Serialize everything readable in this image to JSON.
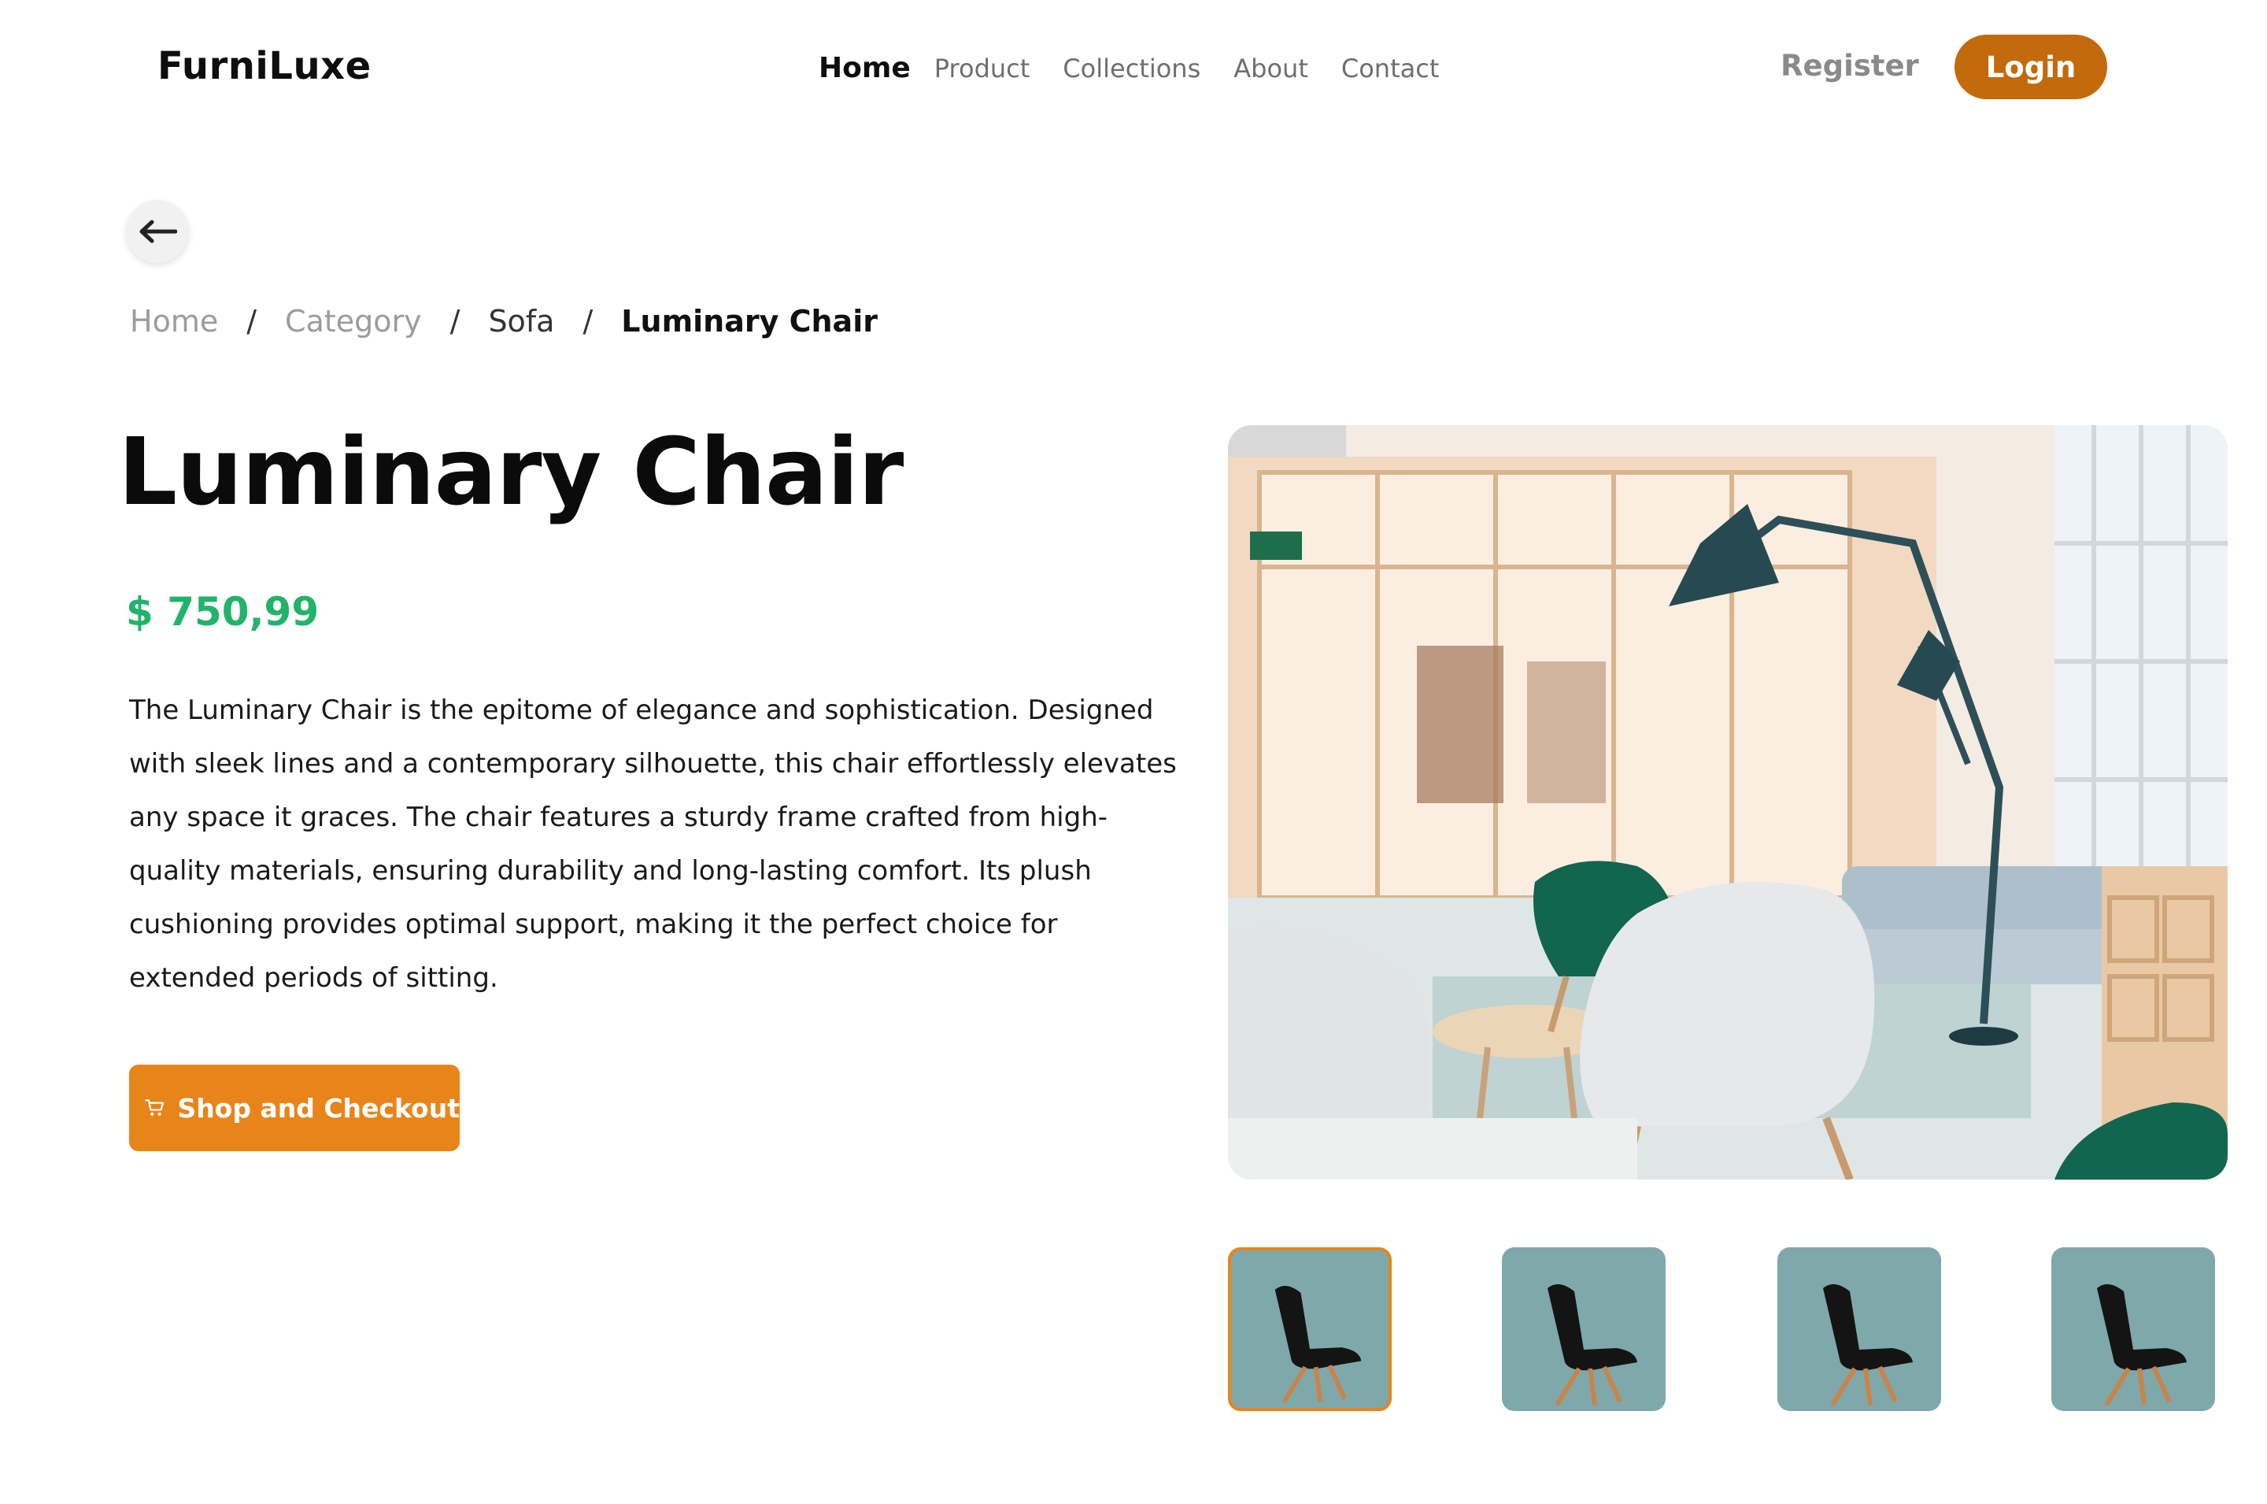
{
  "brand": {
    "name": "FurniLuxe"
  },
  "nav": {
    "items": [
      "Home",
      "Product",
      "Collections",
      "About",
      "Contact"
    ],
    "active": "Home"
  },
  "auth": {
    "register_label": "Register",
    "login_label": "Login"
  },
  "breadcrumb": {
    "home": "Home",
    "category": "Category",
    "sub": "Sofa",
    "current": "Luminary Chair",
    "separator": "/"
  },
  "product": {
    "title": "Luminary Chair",
    "price": "$ 750,99",
    "description_lines": [
      "The Luminary Chair is the epitome of elegance and sophistication. Designed",
      "with sleek lines and a contemporary silhouette, this chair effortlessly elevates",
      "any space it graces. The chair features a sturdy frame crafted from high-",
      "quality materials, ensuring durability and long-lasting comfort. Its plush",
      "cushioning provides optimal support, making it the perfect choice for",
      "extended periods of sitting."
    ],
    "cta_label": "Shop and Checkout",
    "thumbnail_count": 4,
    "active_thumbnail": 1
  },
  "colors": {
    "accent": "#e8851a",
    "login": "#c26a0c",
    "price": "#22b36a",
    "thumb_bg": "#7fa8ab"
  },
  "icons": [
    "back-arrow-icon",
    "cart-icon"
  ]
}
